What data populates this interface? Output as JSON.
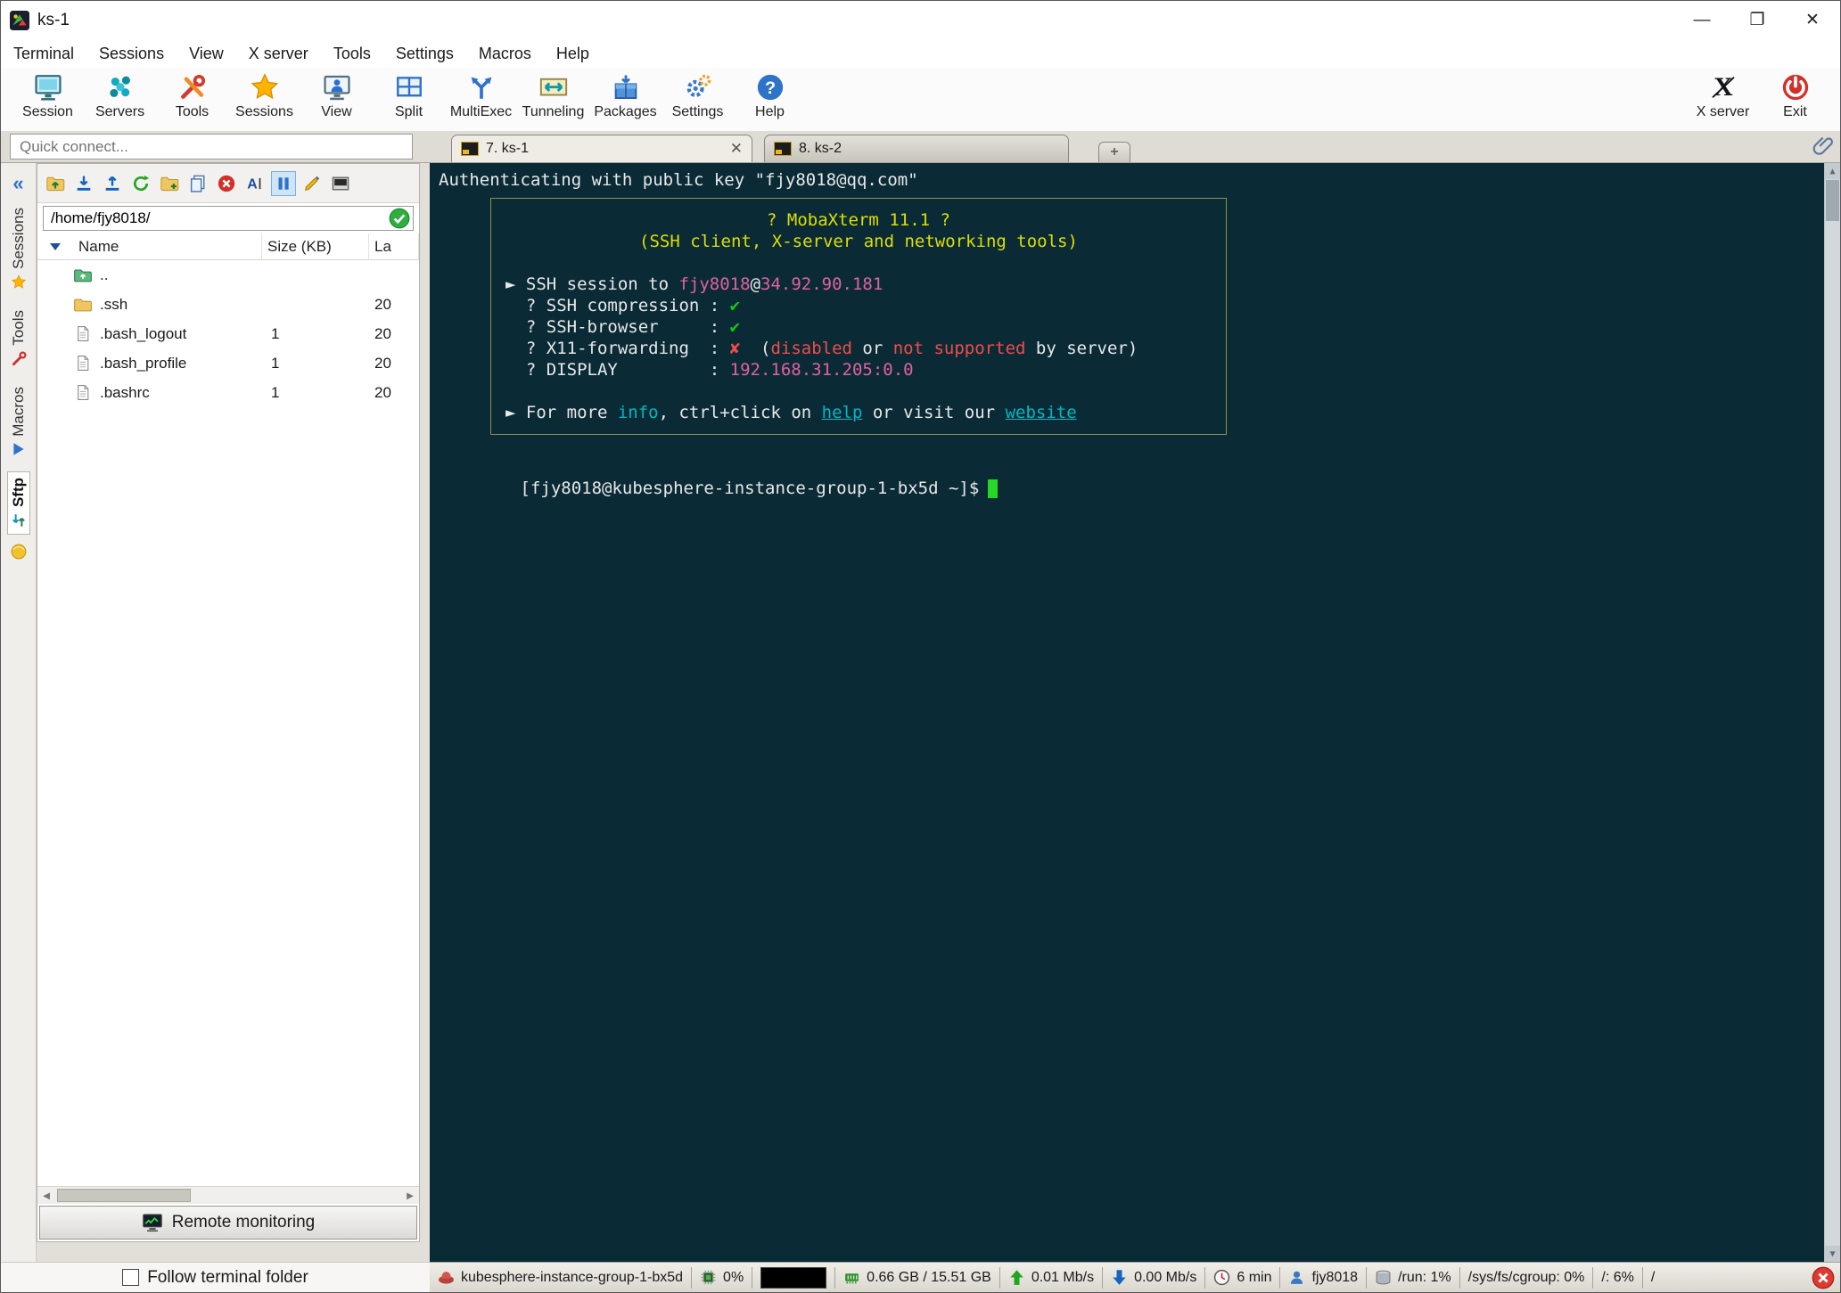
{
  "window": {
    "title": "ks-1",
    "controls": {
      "minimize": "—",
      "maximize": "❐",
      "close": "✕"
    }
  },
  "menubar": {
    "items": [
      "Terminal",
      "Sessions",
      "View",
      "X server",
      "Tools",
      "Settings",
      "Macros",
      "Help"
    ]
  },
  "toolbar": {
    "items": [
      {
        "label": "Session"
      },
      {
        "label": "Servers"
      },
      {
        "label": "Tools"
      },
      {
        "label": "Sessions"
      },
      {
        "label": "View"
      },
      {
        "label": "Split"
      },
      {
        "label": "MultiExec"
      },
      {
        "label": "Tunneling"
      },
      {
        "label": "Packages"
      },
      {
        "label": "Settings"
      },
      {
        "label": "Help"
      }
    ],
    "right_items": [
      {
        "label": "X server"
      },
      {
        "label": "Exit"
      }
    ]
  },
  "quick_connect": {
    "placeholder": "Quick connect..."
  },
  "tab_bar": {
    "tabs": [
      {
        "label": "7. ks-1",
        "active": true
      },
      {
        "label": "8. ks-2",
        "active": false
      }
    ],
    "new_tab_label": "+"
  },
  "side_strip": {
    "collapse": "«",
    "tabs": [
      {
        "label": "Sessions"
      },
      {
        "label": "Tools"
      },
      {
        "label": "Macros"
      },
      {
        "label": "Sftp",
        "active": true
      }
    ]
  },
  "sftp": {
    "toolbar_icons": [
      "go-up",
      "download",
      "upload",
      "refresh",
      "new-folder",
      "copy",
      "delete",
      "rename",
      "pause-sync",
      "edit",
      "open-terminal"
    ],
    "path": "/home/fjy8018/",
    "columns": {
      "name": "Name",
      "size": "Size (KB)",
      "modified": "La"
    },
    "files": [
      {
        "name": "..",
        "size": "",
        "modified": "",
        "type": "parent"
      },
      {
        "name": ".ssh",
        "size": "",
        "modified": "20",
        "type": "folder"
      },
      {
        "name": ".bash_logout",
        "size": "1",
        "modified": "20",
        "type": "file"
      },
      {
        "name": ".bash_profile",
        "size": "1",
        "modified": "20",
        "type": "file"
      },
      {
        "name": ".bashrc",
        "size": "1",
        "modified": "20",
        "type": "file"
      }
    ],
    "remote_monitoring_label": "Remote monitoring",
    "follow_label": "Follow terminal folder"
  },
  "terminal": {
    "auth_line": "Authenticating with public key \"fjy8018@qq.com\"",
    "banner": {
      "lines": [
        {
          "align": "center",
          "segs": [
            {
              "t": "? MobaXterm 11.1 ?",
              "c": "y"
            }
          ]
        },
        {
          "align": "center",
          "segs": [
            {
              "t": "(SSH client, X-server and networking tools)",
              "c": "y"
            }
          ]
        },
        {
          "segs": []
        },
        {
          "segs": [
            {
              "t": "► SSH session to ",
              "c": "w"
            },
            {
              "t": "fjy8018",
              "c": "m"
            },
            {
              "t": "@",
              "c": "w"
            },
            {
              "t": "34.92.90.181",
              "c": "m"
            }
          ]
        },
        {
          "segs": [
            {
              "t": "  ? SSH compression : ",
              "c": "w"
            },
            {
              "t": "✔",
              "c": "g"
            }
          ]
        },
        {
          "segs": [
            {
              "t": "  ? SSH-browser     : ",
              "c": "w"
            },
            {
              "t": "✔",
              "c": "g"
            }
          ]
        },
        {
          "segs": [
            {
              "t": "  ? X11-forwarding  : ",
              "c": "w"
            },
            {
              "t": "✘",
              "c": "r"
            },
            {
              "t": "  (",
              "c": "w"
            },
            {
              "t": "disabled",
              "c": "r"
            },
            {
              "t": " or ",
              "c": "w"
            },
            {
              "t": "not supported",
              "c": "r"
            },
            {
              "t": " by server)",
              "c": "w"
            }
          ]
        },
        {
          "segs": [
            {
              "t": "  ? DISPLAY         : ",
              "c": "w"
            },
            {
              "t": "192.168.31.205:0.0",
              "c": "m"
            }
          ]
        },
        {
          "segs": []
        },
        {
          "segs": [
            {
              "t": "► For more ",
              "c": "w"
            },
            {
              "t": "info",
              "c": "c"
            },
            {
              "t": ", ctrl+click on ",
              "c": "w"
            },
            {
              "t": "help",
              "c": "u"
            },
            {
              "t": " or visit our ",
              "c": "w"
            },
            {
              "t": "website",
              "c": "u"
            }
          ]
        }
      ]
    },
    "prompt": "[fjy8018@kubesphere-instance-group-1-bx5d ~]$",
    "colors": {
      "bg": "#0a2b36",
      "fg": "#e8e8e8",
      "yellow": "#dede00",
      "magenta": "#e35fa4",
      "green": "#16c616",
      "red": "#f14c4c",
      "cyan": "#00b7c3",
      "cursor": "#28d628",
      "border": "#8f9348"
    }
  },
  "statusbar": {
    "host": "kubesphere-instance-group-1-bx5d",
    "cpu_percent": "0%",
    "memory": "0.66 GB / 15.51 GB",
    "upload": "0.01 Mb/s",
    "download": "0.00 Mb/s",
    "uptime": "6 min",
    "user": "fjy8018",
    "disks": [
      "/run: 1%",
      "/sys/fs/cgroup: 0%",
      "/: 6%",
      "/"
    ]
  }
}
